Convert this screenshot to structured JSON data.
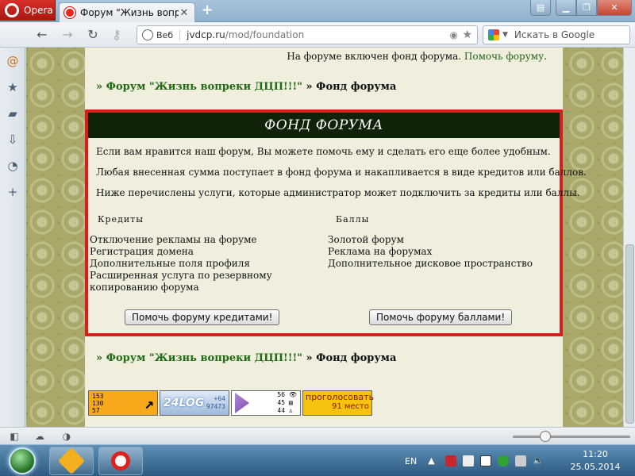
{
  "browser": {
    "app_name": "Opera",
    "tab_title": "Форум \"Жизнь вопреке",
    "url_prefix": "Веб",
    "url_host": "jvdcp.ru",
    "url_path": "/mod/foundation",
    "search_engine_placeholder": "Искать в Google"
  },
  "page": {
    "top_note": "На форуме включен фонд форума.",
    "top_note_link": "Помочь форуму",
    "crumb_link": "Форум \"Жизнь вопреки ДЦП!!!\"",
    "crumb_current": "Фонд форума",
    "crumb_sep": "»",
    "fund": {
      "title": "ФОНД ФОРУМА",
      "paragraphs": [
        "Если вам нравится наш форум, Вы можете помочь ему и сделать его еще более удобным.",
        "Любая внесенная сумма поступает в фонд форума и накапливается в виде кредитов или баллов.",
        "Ниже перечислены услуги, которые администратор может подключить за кредиты или баллы."
      ],
      "credits_header": "Кредиты",
      "points_header": "Баллы",
      "credits_items": [
        "Отключение рекламы на форуме",
        "Регистрация домена",
        "Дополнительные поля профиля",
        "Расширенная услуга по резервному",
        "копированию форума"
      ],
      "points_items": [
        "Золотой форум",
        "Реклама на форумах",
        "Дополнительное дисковое пространство"
      ],
      "credits_button": "Помочь форуму кредитами!",
      "points_button": "Помочь форуму баллами!"
    },
    "counters": {
      "c1": [
        "153",
        "130",
        "57"
      ],
      "c2_logo": "24LOG",
      "c2": [
        "+64",
        "97473"
      ],
      "c3": [
        "56",
        "45",
        "44"
      ],
      "c4_title": "проголосовать",
      "c4_place": "91 место"
    }
  },
  "taskbar": {
    "lang": "EN",
    "time": "11:20",
    "date": "25.05.2014"
  },
  "colors": {
    "accent_red": "#d91d1d",
    "header_green": "#0e2308",
    "link_green": "#1f6a14"
  }
}
